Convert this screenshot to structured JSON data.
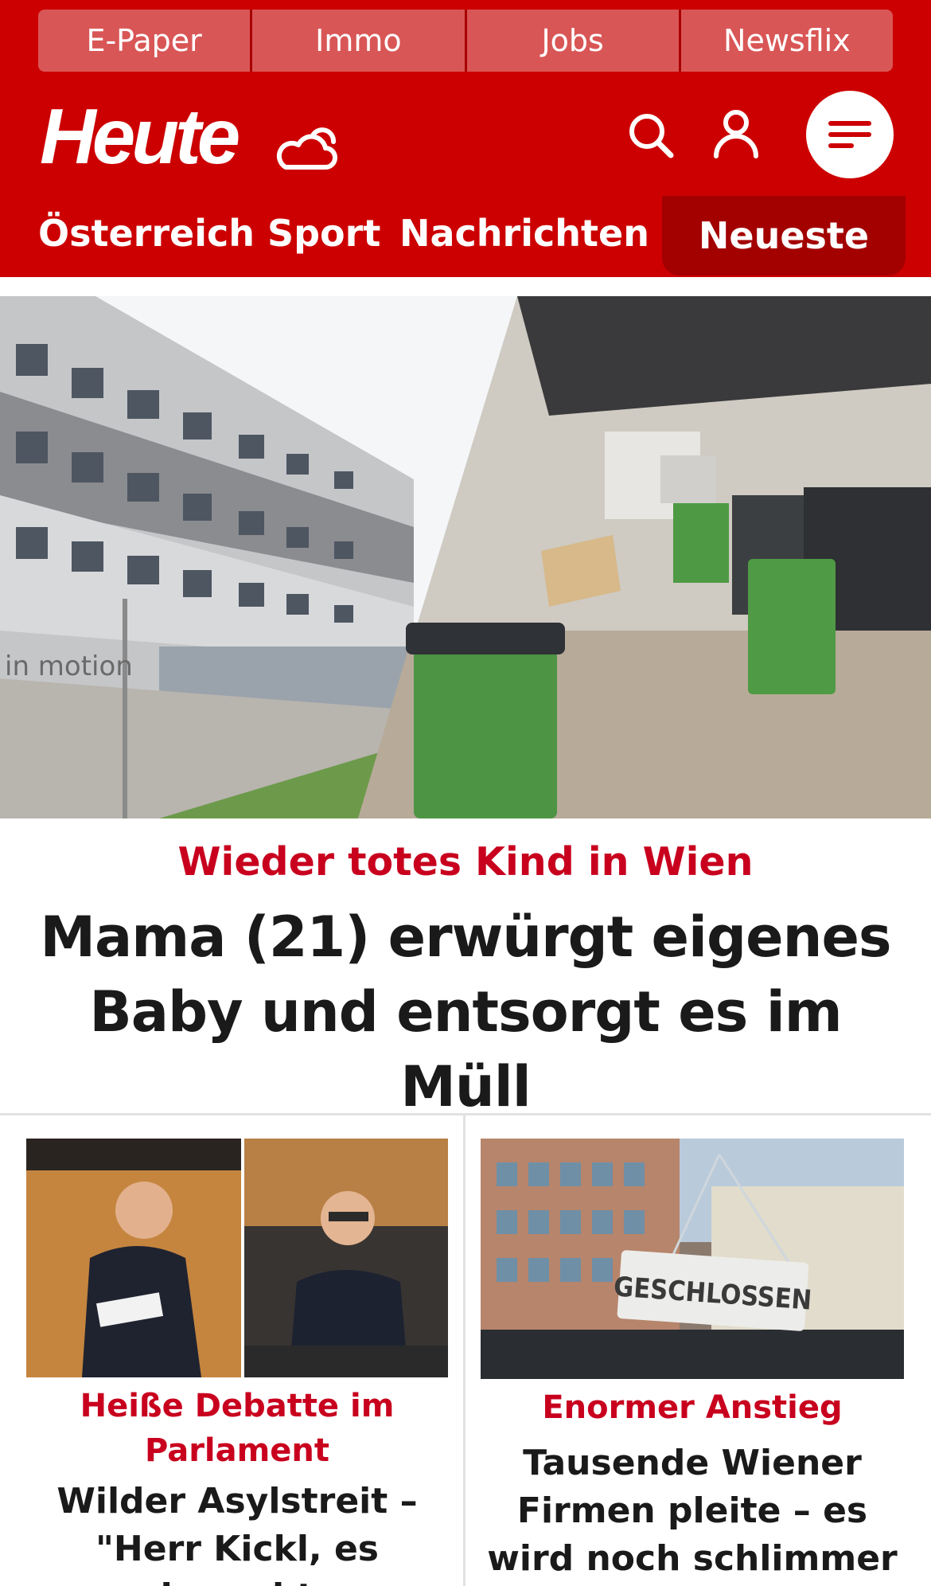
{
  "top_links": [
    "E-Paper",
    "Immo",
    "Jobs",
    "Newsflix"
  ],
  "brand": {
    "logo_text": "Heute"
  },
  "icons": {
    "weather": "cloud-sun-icon",
    "search": "search-icon",
    "user": "user-icon",
    "menu": "menu-icon"
  },
  "nav": {
    "items": [
      "Österreich",
      "Sport",
      "Nachrichten"
    ],
    "highlight": "Neueste"
  },
  "hero": {
    "kicker": "Wieder totes Kind in Wien",
    "title": "Mama (21) erwürgt eigenes Baby und entsorgt es im Müll",
    "image_text": "in motion"
  },
  "teasers": [
    {
      "kicker": "Heiße Debatte im Parlament",
      "title": "Wilder Asylstreit – \"Herr Kickl, es braucht"
    },
    {
      "kicker": "Enormer Anstieg",
      "title": "Tausende Wiener Firmen pleite – es wird noch schlimmer",
      "image_sign_text": "GESCHLOSSEN"
    }
  ],
  "colors": {
    "brand_red": "#cc0000",
    "nav_highlight": "#a30000",
    "kicker_red": "#c8001e",
    "headline": "#1a1a1a"
  }
}
